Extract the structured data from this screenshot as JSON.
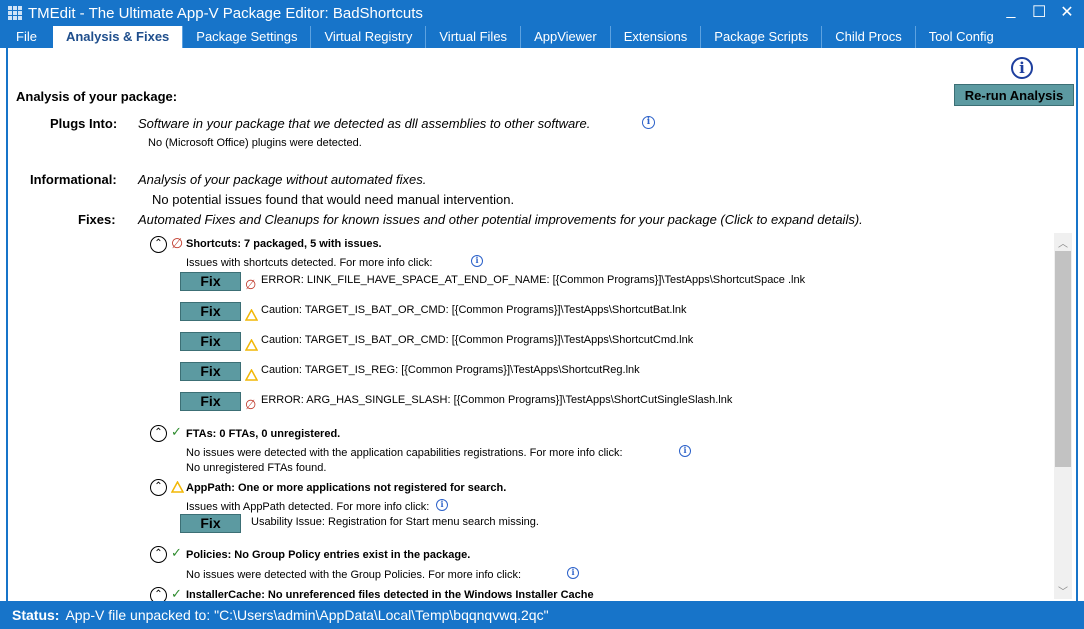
{
  "window": {
    "title": "TMEdit - The Ultimate App-V Package Editor: BadShortcuts"
  },
  "tabs": [
    {
      "label": "File",
      "active": false
    },
    {
      "label": "Analysis & Fixes",
      "active": true
    },
    {
      "label": "Package Settings",
      "active": false
    },
    {
      "label": "Virtual Registry",
      "active": false
    },
    {
      "label": "Virtual Files",
      "active": false
    },
    {
      "label": "AppViewer",
      "active": false
    },
    {
      "label": "Extensions",
      "active": false
    },
    {
      "label": "Package Scripts",
      "active": false
    },
    {
      "label": "Child Procs",
      "active": false
    },
    {
      "label": "Tool Config",
      "active": false
    }
  ],
  "analysis": {
    "heading": "Analysis of your package:",
    "rerun_label": "Re-run Analysis",
    "plugs_into": {
      "label": "Plugs Into:",
      "description": "Software in your package that we detected as dll assemblies to other software.",
      "detail": "No (Microsoft Office) plugins were detected."
    },
    "informational": {
      "label": "Informational:",
      "description": "Analysis of your package without automated fixes.",
      "detail": "No potential issues found that would need manual intervention."
    },
    "fixes": {
      "label": "Fixes:",
      "description": "Automated Fixes and Cleanups for known issues and other potential improvements for your package (Click to expand details)."
    }
  },
  "fix_label": "Fix",
  "sections": {
    "shortcuts": {
      "title": "Shortcuts: 7 packaged, 5 with issues.",
      "subtitle": "Issues with shortcuts detected.  For more info click:",
      "issues": [
        {
          "type": "error",
          "text": "ERROR: LINK_FILE_HAVE_SPACE_AT_END_OF_NAME: [{Common Programs}]\\TestApps\\ShortcutSpace .lnk"
        },
        {
          "type": "caution",
          "text": "Caution: TARGET_IS_BAT_OR_CMD: [{Common Programs}]\\TestApps\\ShortcutBat.lnk"
        },
        {
          "type": "caution",
          "text": "Caution: TARGET_IS_BAT_OR_CMD: [{Common Programs}]\\TestApps\\ShortcutCmd.lnk"
        },
        {
          "type": "caution",
          "text": "Caution: TARGET_IS_REG: [{Common Programs}]\\TestApps\\ShortcutReg.lnk"
        },
        {
          "type": "error",
          "text": "ERROR: ARG_HAS_SINGLE_SLASH: [{Common Programs}]\\TestApps\\ShortCutSingleSlash.lnk"
        }
      ]
    },
    "ftas": {
      "title": "FTAs: 0 FTAs, 0 unregistered.",
      "line1": "No issues were detected with the application capabilities registrations.  For more info click:",
      "line2": "No unregistered FTAs found."
    },
    "apppath": {
      "title": "AppPath: One or more applications not registered for search.",
      "line1": "Issues with AppPath detected.  For more info click:",
      "issue": "Usability Issue: Registration for Start menu search missing."
    },
    "policies": {
      "title": "Policies: No Group Policy entries exist in the package.",
      "line1": "No issues were detected with the Group Policies.  For more info click:"
    },
    "installercache": {
      "title": "InstallerCache: No unreferenced files detected in the Windows Installer Cache"
    }
  },
  "status": {
    "label": "Status:",
    "text": "App-V file unpacked to: \"C:\\Users\\admin\\AppData\\Local\\Temp\\bqqnqvwq.2qc\""
  },
  "colors": {
    "accent": "#1774c9",
    "button": "#5c9aa1",
    "error": "#c0392b",
    "warning": "#f2b705",
    "ok": "#2e8b2e"
  }
}
